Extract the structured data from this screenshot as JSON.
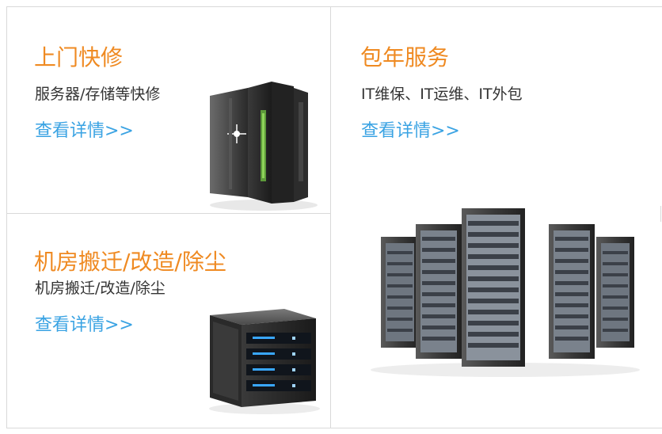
{
  "cards": [
    {
      "title": "上门快修",
      "subtitle": "服务器/存储等快修",
      "link": "查看详情>>",
      "image": "tower-server-icon"
    },
    {
      "title": "包年服务",
      "subtitle": "IT维保、IT运维、IT外包",
      "link": "查看详情>>",
      "image": "server-racks-icon"
    },
    {
      "title": "机房搬迁/改造/除尘",
      "subtitle": "机房搬迁/改造/除尘",
      "link": "查看详情>>",
      "image": "storage-box-icon"
    }
  ],
  "colors": {
    "title": "#ef8a22",
    "subtitle": "#333333",
    "link": "#3aa3e3",
    "border": "#d9d9d9"
  }
}
